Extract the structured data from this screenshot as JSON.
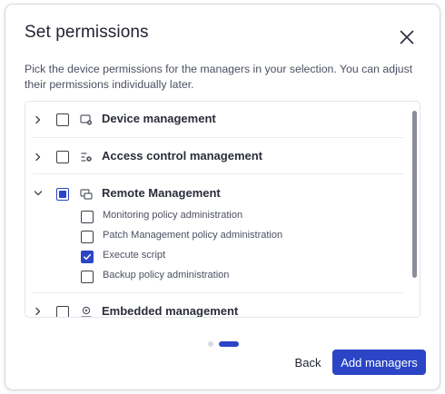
{
  "dialog": {
    "title": "Set permissions",
    "description": "Pick the device permissions for the managers in your selection. You can adjust their permissions individually later."
  },
  "categories": [
    {
      "label": "Device management",
      "expanded": false,
      "state": "unchecked",
      "icon": "device-gear-icon"
    },
    {
      "label": "Access control management",
      "expanded": false,
      "state": "unchecked",
      "icon": "access-control-icon"
    },
    {
      "label": "Remote Management",
      "expanded": true,
      "state": "partial",
      "icon": "remote-screen-icon",
      "children": [
        {
          "label": "Monitoring policy administration",
          "checked": false
        },
        {
          "label": "Patch Management policy administration",
          "checked": false
        },
        {
          "label": "Execute script",
          "checked": true
        },
        {
          "label": "Backup policy administration",
          "checked": false
        }
      ]
    },
    {
      "label": "Embedded management",
      "expanded": false,
      "state": "unchecked",
      "icon": "embedded-chip-icon"
    }
  ],
  "pager": {
    "current": 2,
    "total": 2
  },
  "footer": {
    "back_label": "Back",
    "add_label": "Add managers"
  },
  "colors": {
    "accent": "#2b45c6",
    "scrollbar": "#8a8e98",
    "dot_inactive": "#d9dbe0"
  }
}
